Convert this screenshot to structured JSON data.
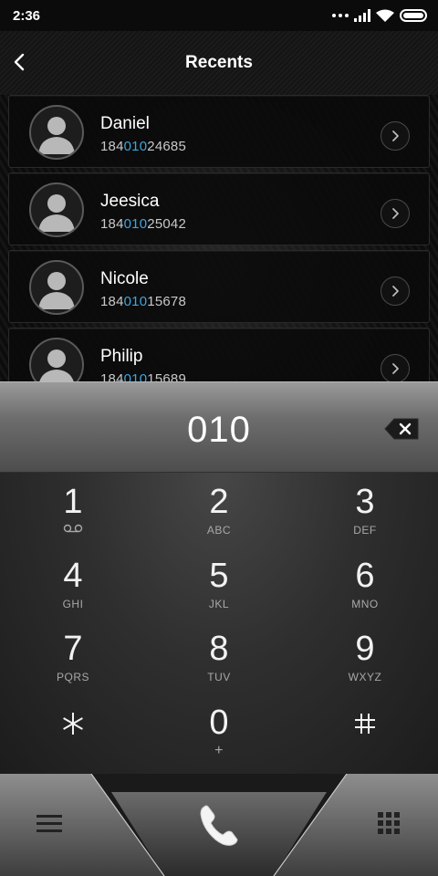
{
  "status_bar": {
    "time": "2:36",
    "icons": [
      "more-dots-icon",
      "signal-icon",
      "wifi-icon",
      "battery-icon"
    ]
  },
  "header": {
    "title": "Recents",
    "back_icon": "chevron-left-icon"
  },
  "contacts": [
    {
      "name": "Daniel",
      "number_pre": "184",
      "number_match": "010",
      "number_post": "24685"
    },
    {
      "name": "Jeesica",
      "number_pre": "184",
      "number_match": "010",
      "number_post": "25042"
    },
    {
      "name": "Nicole",
      "number_pre": "184",
      "number_match": "010",
      "number_post": "15678"
    },
    {
      "name": "Philip",
      "number_pre": "184",
      "number_match": "010",
      "number_post": "15689"
    }
  ],
  "dialer": {
    "number": "010",
    "backspace_icon": "backspace-icon"
  },
  "keypad": [
    {
      "digit": "1",
      "letters": "",
      "sub_icon": "voicemail-icon"
    },
    {
      "digit": "2",
      "letters": "ABC"
    },
    {
      "digit": "3",
      "letters": "DEF"
    },
    {
      "digit": "4",
      "letters": "GHI"
    },
    {
      "digit": "5",
      "letters": "JKL"
    },
    {
      "digit": "6",
      "letters": "MNO"
    },
    {
      "digit": "7",
      "letters": "PQRS"
    },
    {
      "digit": "8",
      "letters": "TUV"
    },
    {
      "digit": "9",
      "letters": "WXYZ"
    },
    {
      "digit": "*",
      "letters": ""
    },
    {
      "digit": "0",
      "letters": "+"
    },
    {
      "digit": "#",
      "letters": ""
    }
  ],
  "bottom_bar": {
    "left_icon": "menu-icon",
    "center_icon": "phone-icon",
    "right_icon": "dialpad-grid-icon"
  },
  "colors": {
    "match_highlight": "#3ea6e0",
    "background": "#000000",
    "display_gradient_top": "#9a9a9a",
    "display_gradient_bottom": "#4d4d4d"
  }
}
